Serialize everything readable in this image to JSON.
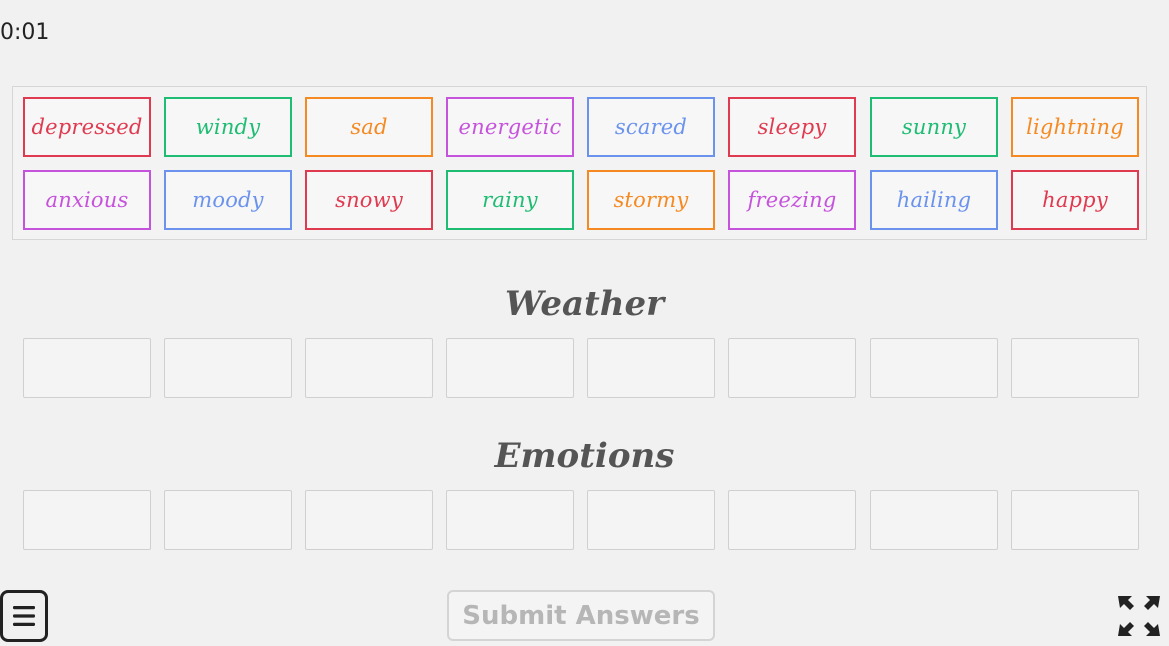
{
  "timer": "0:01",
  "bank_cards": [
    {
      "label": "depressed",
      "color": "#e03a50"
    },
    {
      "label": "windy",
      "color": "#1fbc74"
    },
    {
      "label": "sad",
      "color": "#f58a22"
    },
    {
      "label": "energetic",
      "color": "#c653dc"
    },
    {
      "label": "scared",
      "color": "#6b93ee"
    },
    {
      "label": "sleepy",
      "color": "#e03a50"
    },
    {
      "label": "sunny",
      "color": "#1fbc74"
    },
    {
      "label": "lightning",
      "color": "#f58a22"
    },
    {
      "label": "anxious",
      "color": "#c653dc"
    },
    {
      "label": "moody",
      "color": "#6b93ee"
    },
    {
      "label": "snowy",
      "color": "#e03a50"
    },
    {
      "label": "rainy",
      "color": "#1fbc74"
    },
    {
      "label": "stormy",
      "color": "#f58a22"
    },
    {
      "label": "freezing",
      "color": "#c653dc"
    },
    {
      "label": "hailing",
      "color": "#6b93ee"
    },
    {
      "label": "happy",
      "color": "#e03a50"
    }
  ],
  "categories": [
    {
      "title": "Weather"
    },
    {
      "title": "Emotions"
    }
  ],
  "submit_label": "Submit Answers",
  "icons": {
    "menu": "menu-icon",
    "fullscreen": "fullscreen-icon"
  }
}
